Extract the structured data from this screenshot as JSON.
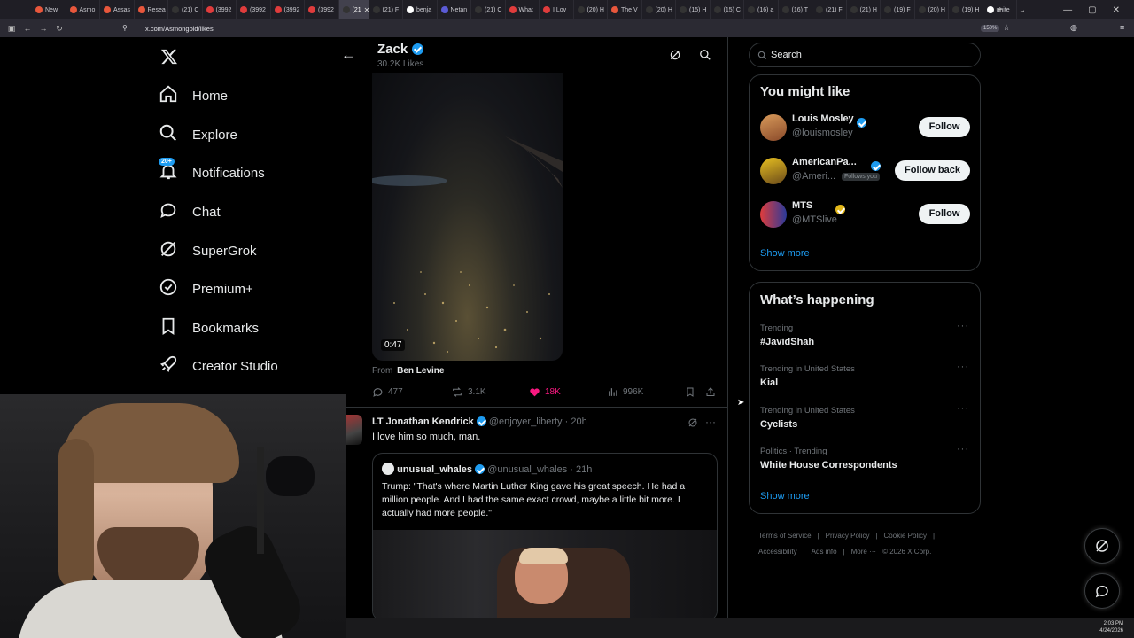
{
  "browser": {
    "tabs": [
      {
        "label": "New",
        "color": "#e8573c"
      },
      {
        "label": "Asmo",
        "color": "#e8573c"
      },
      {
        "label": "Assas",
        "color": "#e8573c"
      },
      {
        "label": "Resea",
        "color": "#e8573c"
      },
      {
        "label": "(21) C",
        "color": "#333333"
      },
      {
        "label": "(3992",
        "color": "#e03c3c"
      },
      {
        "label": "(3992",
        "color": "#e03c3c"
      },
      {
        "label": "(3992",
        "color": "#e03c3c"
      },
      {
        "label": "(3992",
        "color": "#e03c3c"
      },
      {
        "label": "(21",
        "color": "#333333"
      },
      {
        "label": "(21) F",
        "color": "#333333"
      },
      {
        "label": "benja",
        "color": "#ffffff"
      },
      {
        "label": "Netan",
        "color": "#5b5bd6"
      },
      {
        "label": "(21) C",
        "color": "#333333"
      },
      {
        "label": "What",
        "color": "#e03c3c"
      },
      {
        "label": "I Lov",
        "color": "#e03c3c"
      },
      {
        "label": "(20) H",
        "color": "#333333"
      },
      {
        "label": "The V",
        "color": "#e8573c"
      },
      {
        "label": "(20) H",
        "color": "#333333"
      },
      {
        "label": "(15) H",
        "color": "#333333"
      },
      {
        "label": "(15) C",
        "color": "#333333"
      },
      {
        "label": "(16) a",
        "color": "#333333"
      },
      {
        "label": "(16) T",
        "color": "#333333"
      },
      {
        "label": "(21) F",
        "color": "#333333"
      },
      {
        "label": "(21) H",
        "color": "#333333"
      },
      {
        "label": "(19) F",
        "color": "#333333"
      },
      {
        "label": "(20) H",
        "color": "#333333"
      },
      {
        "label": "(19) H",
        "color": "#333333"
      },
      {
        "label": "unite",
        "color": "#ffffff"
      }
    ],
    "url": "x.com/Asmongold/likes",
    "zoom": "150%"
  },
  "nav": {
    "items": [
      {
        "label": "Home",
        "icon": "home-icon"
      },
      {
        "label": "Explore",
        "icon": "search-icon"
      },
      {
        "label": "Notifications",
        "icon": "bell-icon",
        "badge": "20+"
      },
      {
        "label": "Chat",
        "icon": "chat-icon"
      },
      {
        "label": "SuperGrok",
        "icon": "grok-icon"
      },
      {
        "label": "Premium+",
        "icon": "premium-icon"
      },
      {
        "label": "Bookmarks",
        "icon": "bookmark-icon"
      },
      {
        "label": "Creator Studio",
        "icon": "rocket-icon"
      }
    ]
  },
  "profile": {
    "name": "Zack",
    "likes_count": "30.2K Likes"
  },
  "post1": {
    "video_duration": "0:47",
    "from_label": "From",
    "from_name": "Ben Levine",
    "replies": "477",
    "reposts": "3.1K",
    "likes": "18K",
    "views": "996K"
  },
  "post2": {
    "author_name": "LT Jonathan Kendrick",
    "author_handle": "@enjoyer_liberty",
    "time": "· 20h",
    "text": "I love him so much, man.",
    "quote": {
      "author_name": "unusual_whales",
      "author_handle": "@unusual_whales",
      "time": "· 21h",
      "text": "Trump: \"That's where Martin Luther King gave his great speech. He had a million people. And I had the same exact crowd, maybe a little bit more. I actually had more people.\""
    }
  },
  "search": {
    "placeholder": "Search"
  },
  "suggestions": {
    "title": "You might like",
    "people": [
      {
        "name": "Louis Mosley",
        "handle": "@louismosley",
        "button": "Follow",
        "follows_you": ""
      },
      {
        "name": "AmericanPa...",
        "handle": "@Ameri...",
        "button": "Follow back",
        "follows_you": "Follows you"
      },
      {
        "name": "MTS",
        "handle": "@MTSlive",
        "button": "Follow",
        "follows_you": ""
      }
    ],
    "show_more": "Show more"
  },
  "trends": {
    "title": "What’s happening",
    "items": [
      {
        "category": "Trending",
        "name": "#JavidShah"
      },
      {
        "category": "Trending in United States",
        "name": "Kial"
      },
      {
        "category": "Trending in United States",
        "name": "Cyclists"
      },
      {
        "category": "Politics · Trending",
        "name": "White House Correspondents"
      }
    ],
    "show_more": "Show more"
  },
  "footer": {
    "links": [
      "Terms of Service",
      "Privacy Policy",
      "Cookie Policy",
      "Accessibility",
      "Ads info",
      "More ···"
    ],
    "copyright": "© 2026 X Corp."
  },
  "taskbar": {
    "time": "2:03 PM",
    "date": "4/24/2026"
  },
  "colors": {
    "accent": "#1d9bf0",
    "like_pink": "#f91880",
    "background": "#000000"
  }
}
